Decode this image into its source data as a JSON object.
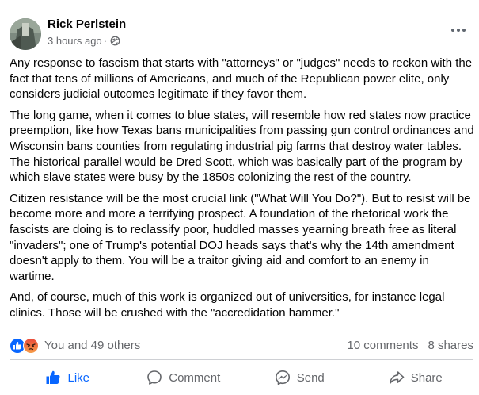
{
  "post": {
    "author": "Rick Perlstein",
    "timestamp": "3 hours ago",
    "separator": "·",
    "privacy_icon": "globe-icon",
    "menu_icon": "more-options-icon",
    "paragraphs": [
      "Any response to fascism that starts with \"attorneys\" or \"judges\" needs to reckon with the fact that tens of millions of Americans, and much of the Republican power elite, only considers judicial outcomes legitimate if they favor them.",
      "The long game, when it comes to blue states, will resemble how red states now practice preemption, like how Texas bans municipalities from passing gun control ordinances and Wisconsin bans counties from regulating industrial pig farms that destroy water tables. The historical parallel would be Dred Scott, which was basically part of the program by which slave states were busy by the 1850s colonizing the rest of the country.",
      "Citizen resistance will be the most crucial link (\"What Will You Do?\"). But to resist will be become more and more a terrifying prospect. A foundation of the rhetorical work the fascists are doing is to reclassify poor, huddled masses yearning breath free as literal \"invaders\"; one of Trump's potential DOJ heads says that's why the 14th amendment doesn't apply to them. You will be a traitor giving aid and comfort to an enemy in wartime.",
      "And, of course, much of this work is organized out of universities, for instance legal clinics. Those will be crushed with the \"accredidation hammer.\""
    ]
  },
  "reactions": {
    "icons": [
      "like-reaction-icon",
      "angry-reaction-icon"
    ],
    "summary": "You and 49 others",
    "comments": "10 comments",
    "shares": "8 shares"
  },
  "actions": {
    "like": "Like",
    "comment": "Comment",
    "send": "Send",
    "share": "Share"
  },
  "colors": {
    "like_blue": "#0866ff",
    "angry_orange": "#f7714a",
    "secondary_text": "#65676b",
    "primary_text": "#050505"
  }
}
